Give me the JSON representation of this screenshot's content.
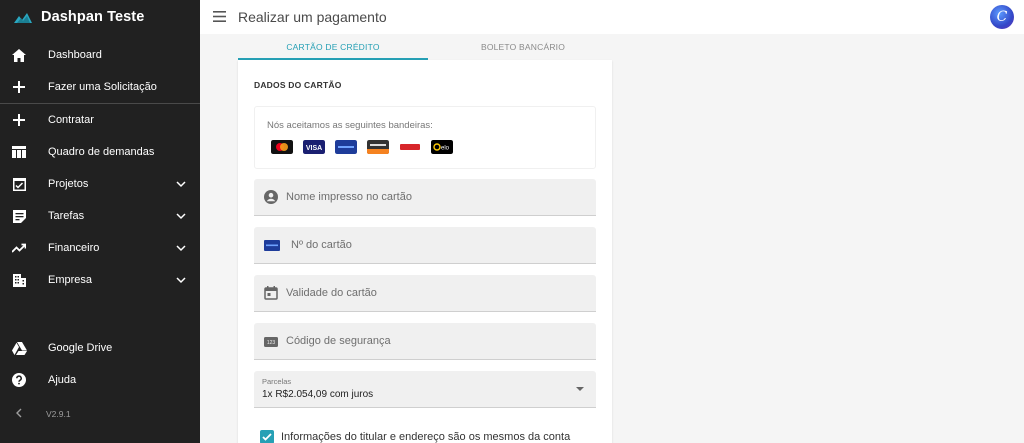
{
  "app": {
    "brand_name": "Dashpan Teste",
    "version": "V2.9.1"
  },
  "sidebar": {
    "items": [
      {
        "label": "Dashboard",
        "icon": "home-icon"
      },
      {
        "label": "Fazer uma Solicitação",
        "icon": "plus-icon"
      },
      {
        "label": "Contratar",
        "icon": "plus-icon"
      },
      {
        "label": "Quadro de demandas",
        "icon": "board-icon"
      },
      {
        "label": "Projetos",
        "icon": "checkbox-icon",
        "expandable": true
      },
      {
        "label": "Tarefas",
        "icon": "note-icon",
        "expandable": true
      },
      {
        "label": "Financeiro",
        "icon": "trending-up-icon",
        "expandable": true
      },
      {
        "label": "Empresa",
        "icon": "building-icon",
        "expandable": true
      },
      {
        "label": "Google Drive",
        "icon": "drive-icon"
      },
      {
        "label": "Ajuda",
        "icon": "help-icon"
      }
    ]
  },
  "header": {
    "title": "Realizar um pagamento",
    "avatar_letter": "C"
  },
  "tabs": [
    {
      "label": "CARTÃO DE CRÉDITO",
      "active": true
    },
    {
      "label": "BOLETO BANCÁRIO",
      "active": false
    }
  ],
  "card": {
    "section_title": "DADOS DO CARTÃO",
    "brands_label": "Nós aceitamos as seguintes bandeiras:",
    "brands": [
      "Mastercard",
      "Visa",
      "Amex",
      "Discover",
      "Hipercard",
      "Elo"
    ],
    "fields": {
      "name_placeholder": "Nome impresso no cartão",
      "number_placeholder": "Nº do cartão",
      "expiry_placeholder": "Validade do cartão",
      "cvv_placeholder": "Código de segurança"
    },
    "installments": {
      "label": "Parcelas",
      "value": "1x R$2.054,09 com juros"
    },
    "same_info_checkbox": {
      "label": "Informações do titular e endereço são os mesmos da conta",
      "checked": true
    }
  },
  "colors": {
    "accent": "#26a0b5",
    "sidebar_bg": "#212121"
  }
}
